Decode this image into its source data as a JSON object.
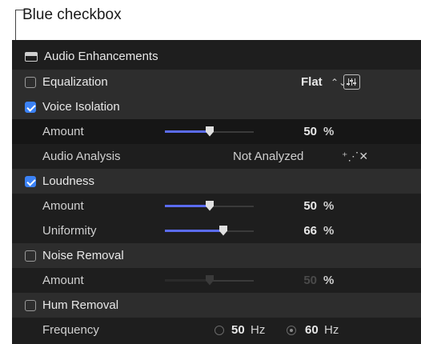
{
  "callout": {
    "text": "Blue checkbox"
  },
  "panel": {
    "title": "Audio Enhancements",
    "equalization": {
      "label": "Equalization",
      "checked": false,
      "value": "Flat"
    },
    "voice_isolation": {
      "label": "Voice Isolation",
      "checked": true,
      "amount_label": "Amount",
      "amount_value": "50",
      "amount_unit": "%",
      "amount_level": 0.5,
      "analysis_label": "Audio Analysis",
      "analysis_value": "Not Analyzed"
    },
    "loudness": {
      "label": "Loudness",
      "checked": true,
      "amount_label": "Amount",
      "amount_value": "50",
      "amount_unit": "%",
      "amount_level": 0.5,
      "uniformity_label": "Uniformity",
      "uniformity_value": "66",
      "uniformity_unit": "%",
      "uniformity_level": 0.66
    },
    "noise_removal": {
      "label": "Noise Removal",
      "checked": false,
      "amount_label": "Amount",
      "amount_value": "50",
      "amount_unit": "%",
      "amount_level": 0.5
    },
    "hum_removal": {
      "label": "Hum Removal",
      "checked": false,
      "frequency_label": "Frequency",
      "options": [
        {
          "value": "50",
          "unit": "Hz",
          "selected": false
        },
        {
          "value": "60",
          "unit": "Hz",
          "selected": true
        }
      ]
    },
    "accent_color": "#3b82f6",
    "slider_color": "#5b6cf0"
  }
}
